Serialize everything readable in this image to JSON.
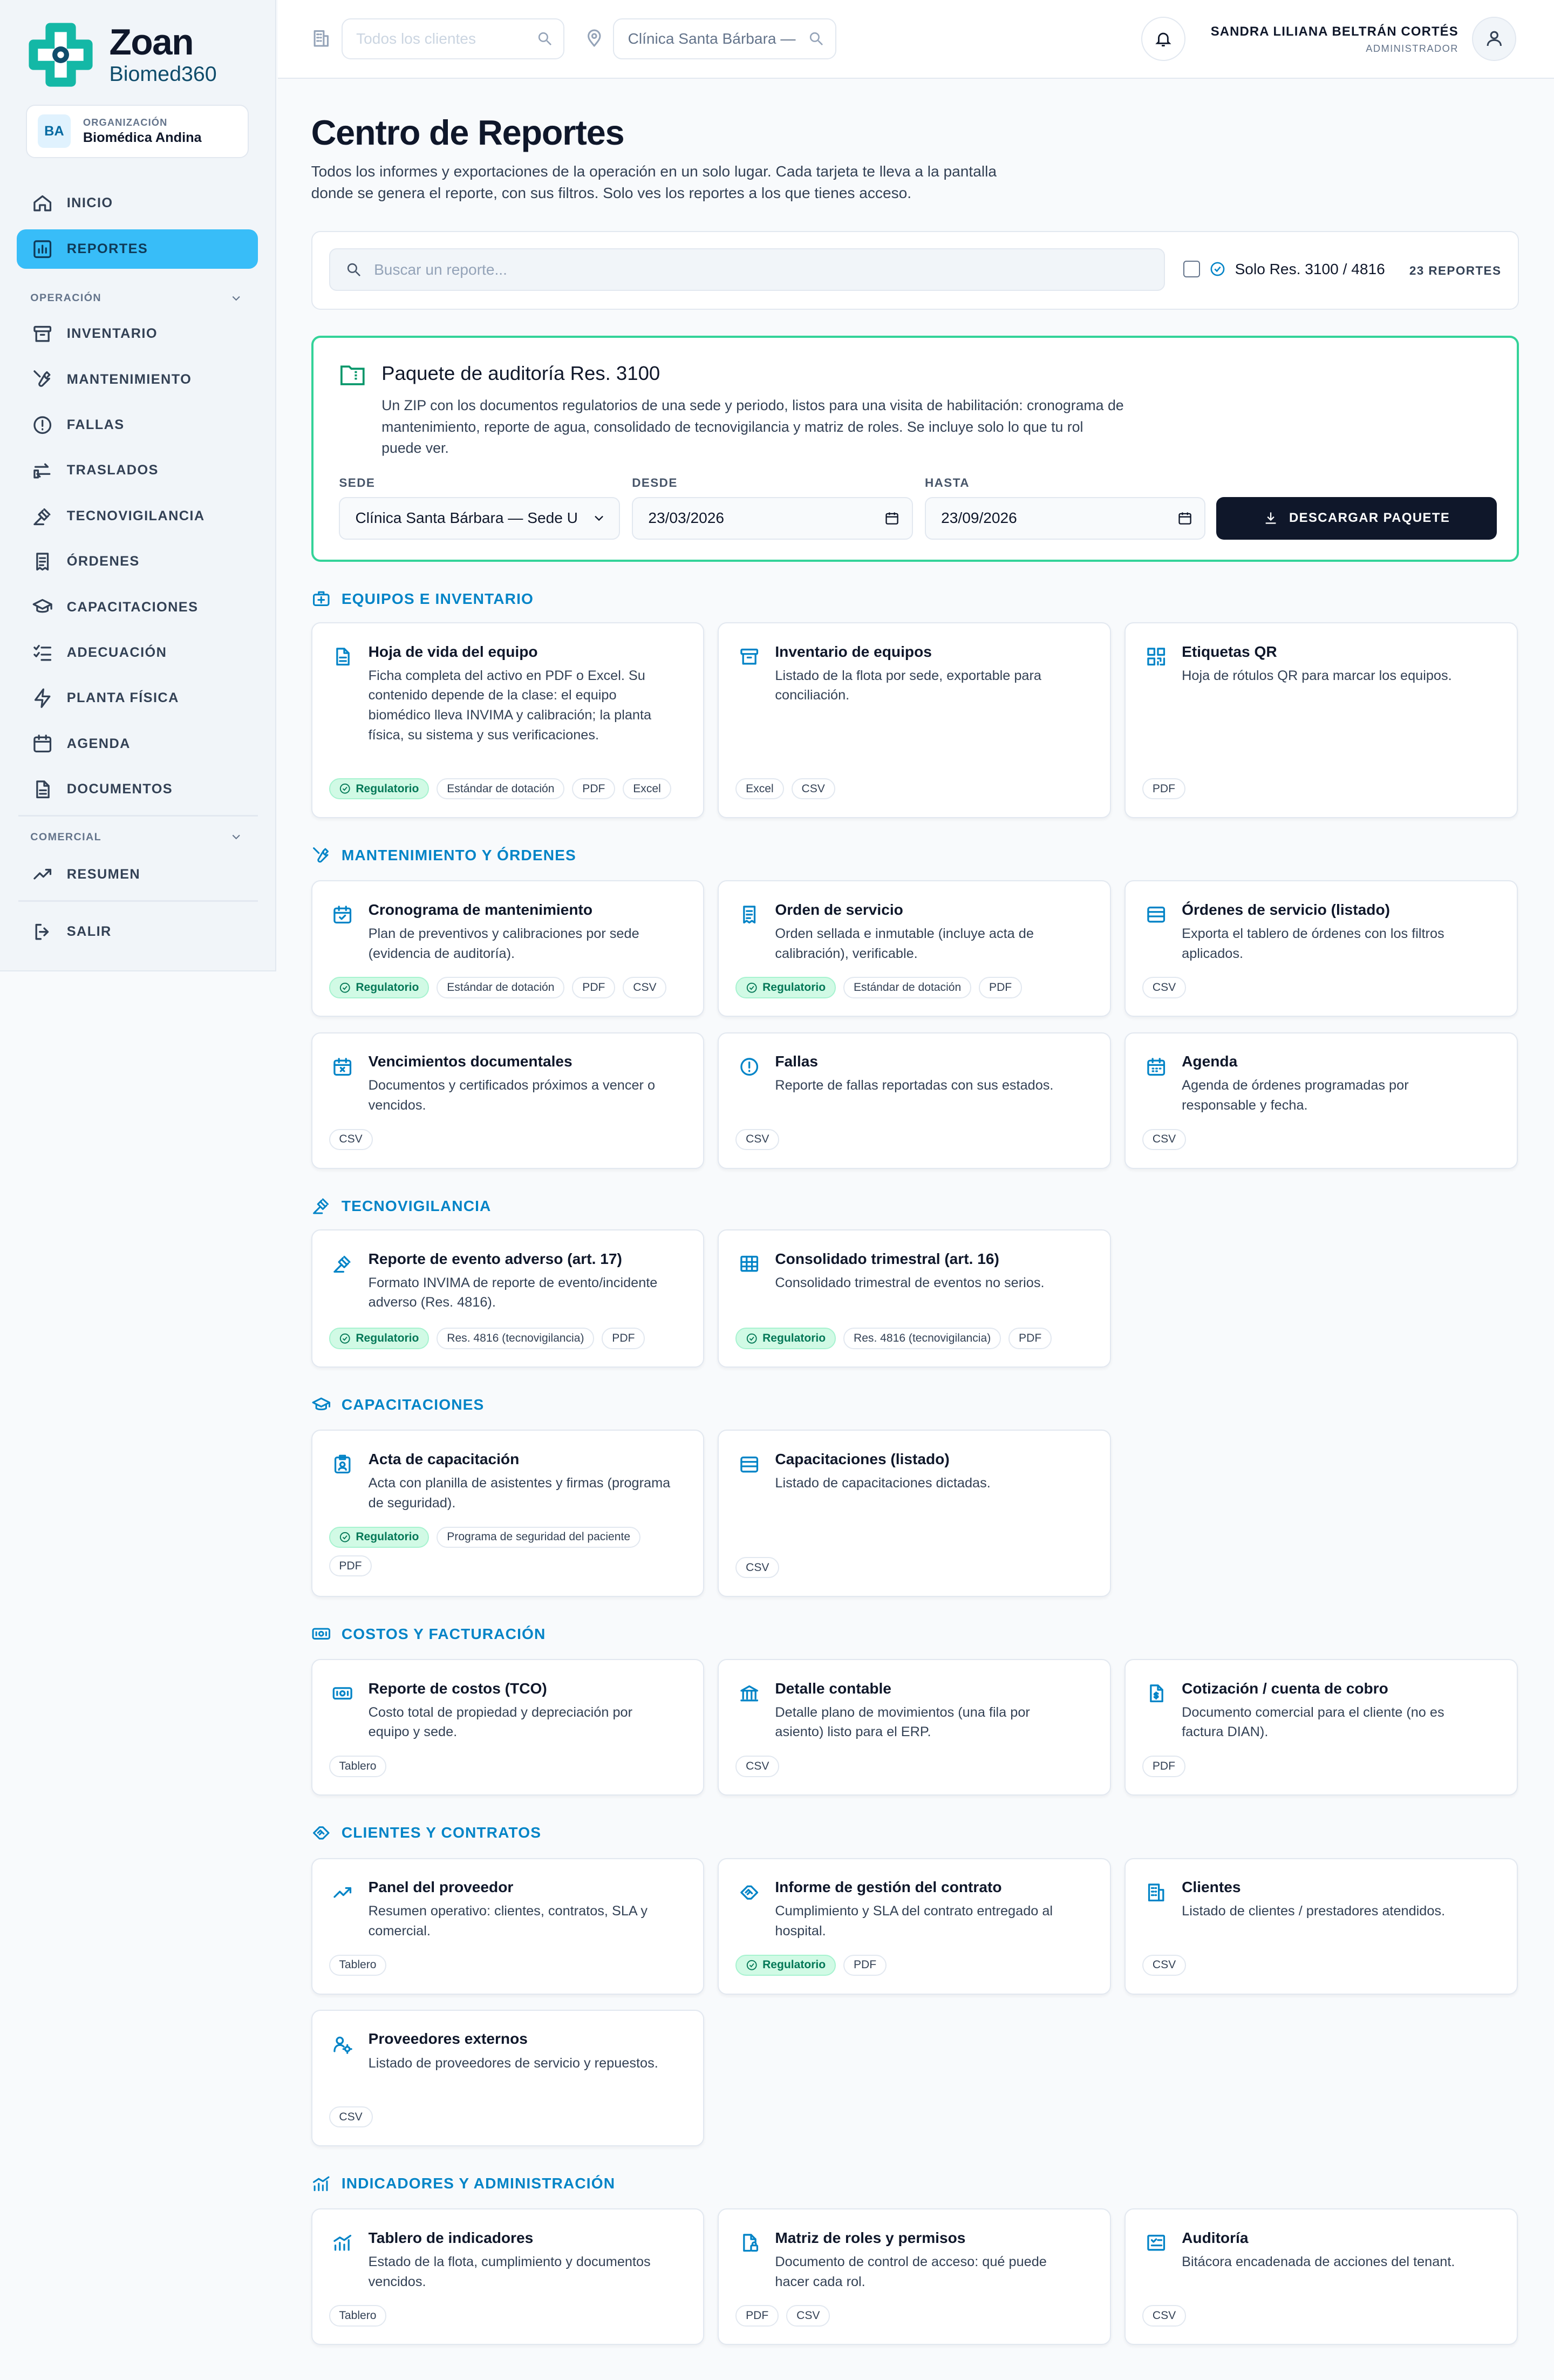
{
  "brand": {
    "name": "Zoan",
    "sub": "Biomed360"
  },
  "org": {
    "badge": "BA",
    "label": "ORGANIZACIÓN",
    "name": "Biomédica Andina"
  },
  "nav": {
    "inicio": "INICIO",
    "reportes": "REPORTES",
    "section_operacion": "OPERACIÓN",
    "inventario": "INVENTARIO",
    "mantenimiento": "MANTENIMIENTO",
    "fallas": "FALLAS",
    "traslados": "TRASLADOS",
    "tecnovigilancia": "TECNOVIGILANCIA",
    "ordenes": "ÓRDENES",
    "capacitaciones": "CAPACITACIONES",
    "adecuacion": "ADECUACIÓN",
    "planta": "PLANTA FÍSICA",
    "agenda": "AGENDA",
    "documentos": "DOCUMENTOS",
    "section_comercial": "COMERCIAL",
    "resumen": "RESUMEN",
    "salir": "SALIR"
  },
  "topbar": {
    "client_placeholder": "Todos los clientes",
    "site_value": "Clínica Santa Bárbara —",
    "user_name": "SANDRA LILIANA BELTRÁN CORTÉS",
    "user_role": "ADMINISTRADOR"
  },
  "page": {
    "title": "Centro de Reportes",
    "description": "Todos los informes y exportaciones de la operación en un solo lugar. Cada tarjeta te lleva a la pantalla donde se genera el reporte, con sus filtros. Solo ves los reportes a los que tienes acceso."
  },
  "search": {
    "placeholder": "Buscar un reporte...",
    "filter_label": "Solo Res. 3100 / 4816",
    "count": "23 REPORTES"
  },
  "audit": {
    "title": "Paquete de auditoría Res. 3100",
    "description": "Un ZIP con los documentos regulatorios de una sede y periodo, listos para una visita de habilitación: cronograma de mantenimiento, reporte de agua, consolidado de tecnovigilancia y matriz de roles. Se incluye solo lo que tu rol puede ver.",
    "sede_label": "SEDE",
    "sede_value": "Clínica Santa Bárbara — Sede U",
    "desde_label": "DESDE",
    "desde_value": "23/03/2026",
    "hasta_label": "HASTA",
    "hasta_value": "23/09/2026",
    "button": "DESCARGAR PAQUETE"
  },
  "sections": {
    "equipos": "EQUIPOS E INVENTARIO",
    "mantenimiento": "MANTENIMIENTO Y ÓRDENES",
    "tecnovigilancia": "TECNOVIGILANCIA",
    "capacitaciones": "CAPACITACIONES",
    "costos": "COSTOS Y FACTURACIÓN",
    "clientes": "CLIENTES Y CONTRATOS",
    "indicadores": "INDICADORES Y ADMINISTRACIÓN"
  },
  "cards": {
    "hoja_vida": {
      "title": "Hoja de vida del equipo",
      "desc": "Ficha completa del activo en PDF o Excel. Su contenido depende de la clase: el equipo biomédico lleva INVIMA y calibración; la planta física, su sistema y sus verificaciones.",
      "tags": [
        "Regulatorio",
        "Estándar de dotación",
        "PDF",
        "Excel"
      ]
    },
    "inventario": {
      "title": "Inventario de equipos",
      "desc": "Listado de la flota por sede, exportable para conciliación.",
      "tags": [
        "Excel",
        "CSV"
      ]
    },
    "qr": {
      "title": "Etiquetas QR",
      "desc": "Hoja de rótulos QR para marcar los equipos.",
      "tags": [
        "PDF"
      ]
    },
    "cronograma": {
      "title": "Cronograma de mantenimiento",
      "desc": "Plan de preventivos y calibraciones por sede (evidencia de auditoría).",
      "tags": [
        "Regulatorio",
        "Estándar de dotación",
        "PDF",
        "CSV"
      ]
    },
    "orden": {
      "title": "Orden de servicio",
      "desc": "Orden sellada e inmutable (incluye acta de calibración), verificable.",
      "tags": [
        "Regulatorio",
        "Estándar de dotación",
        "PDF"
      ]
    },
    "ordenes_listado": {
      "title": "Órdenes de servicio (listado)",
      "desc": "Exporta el tablero de órdenes con los filtros aplicados.",
      "tags": [
        "CSV"
      ]
    },
    "vencimientos": {
      "title": "Vencimientos documentales",
      "desc": "Documentos y certificados próximos a vencer o vencidos.",
      "tags": [
        "CSV"
      ]
    },
    "fallas": {
      "title": "Fallas",
      "desc": "Reporte de fallas reportadas con sus estados.",
      "tags": [
        "CSV"
      ]
    },
    "agenda": {
      "title": "Agenda",
      "desc": "Agenda de órdenes programadas por responsable y fecha.",
      "tags": [
        "CSV"
      ]
    },
    "evento": {
      "title": "Reporte de evento adverso (art. 17)",
      "desc": "Formato INVIMA de reporte de evento/incidente adverso (Res. 4816).",
      "tags": [
        "Regulatorio",
        "Res. 4816 (tecnovigilancia)",
        "PDF"
      ]
    },
    "consolidado": {
      "title": "Consolidado trimestral (art. 16)",
      "desc": "Consolidado trimestral de eventos no serios.",
      "tags": [
        "Regulatorio",
        "Res. 4816 (tecnovigilancia)",
        "PDF"
      ]
    },
    "acta": {
      "title": "Acta de capacitación",
      "desc": "Acta con planilla de asistentes y firmas (programa de seguridad).",
      "tags": [
        "Regulatorio",
        "Programa de seguridad del paciente",
        "PDF"
      ]
    },
    "cap_listado": {
      "title": "Capacitaciones (listado)",
      "desc": "Listado de capacitaciones dictadas.",
      "tags": [
        "CSV"
      ]
    },
    "costos": {
      "title": "Reporte de costos (TCO)",
      "desc": "Costo total de propiedad y depreciación por equipo y sede.",
      "tags": [
        "Tablero"
      ]
    },
    "contable": {
      "title": "Detalle contable",
      "desc": "Detalle plano de movimientos (una fila por asiento) listo para el ERP.",
      "tags": [
        "CSV"
      ]
    },
    "cotizacion": {
      "title": "Cotización / cuenta de cobro",
      "desc": "Documento comercial para el cliente (no es factura DIAN).",
      "tags": [
        "PDF"
      ]
    },
    "panel": {
      "title": "Panel del proveedor",
      "desc": "Resumen operativo: clientes, contratos, SLA y comercial.",
      "tags": [
        "Tablero"
      ]
    },
    "gestion": {
      "title": "Informe de gestión del contrato",
      "desc": "Cumplimiento y SLA del contrato entregado al hospital.",
      "tags": [
        "Regulatorio",
        "PDF"
      ]
    },
    "clientes": {
      "title": "Clientes",
      "desc": "Listado de clientes / prestadores atendidos.",
      "tags": [
        "CSV"
      ]
    },
    "proveedores": {
      "title": "Proveedores externos",
      "desc": "Listado de proveedores de servicio y repuestos.",
      "tags": [
        "CSV"
      ]
    },
    "indicadores": {
      "title": "Tablero de indicadores",
      "desc": "Estado de la flota, cumplimiento y documentos vencidos.",
      "tags": [
        "Tablero"
      ]
    },
    "matriz": {
      "title": "Matriz de roles y permisos",
      "desc": "Documento de control de acceso: qué puede hacer cada rol.",
      "tags": [
        "PDF",
        "CSV"
      ]
    },
    "auditoria": {
      "title": "Auditoría",
      "desc": "Bitácora encadenada de acciones del tenant.",
      "tags": [
        "CSV"
      ]
    }
  }
}
